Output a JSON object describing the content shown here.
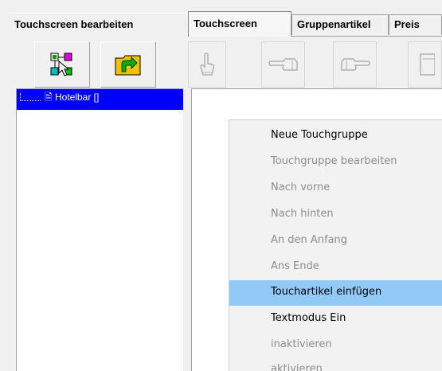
{
  "tabs": {
    "outer": "Touchscreen bearbeiten",
    "inner": [
      "Touchscreen",
      "Gruppenartikel",
      "Preis"
    ]
  },
  "toolbar": {
    "buttons": [
      {
        "icon": "select-cursor-icon",
        "enabled": true
      },
      {
        "icon": "folder-arrow-icon",
        "enabled": true
      },
      {
        "icon": "hand-point-up-icon",
        "enabled": false
      },
      {
        "icon": "hand-point-left-icon",
        "enabled": false
      },
      {
        "icon": "hand-point-right-icon",
        "enabled": false
      },
      {
        "icon": "device-icon",
        "enabled": false
      }
    ]
  },
  "tree": {
    "selected_label": "Hotelbar []"
  },
  "context_menu": {
    "items": [
      {
        "label": "Neue Touchgruppe",
        "enabled": true,
        "highlighted": false
      },
      {
        "label": "Touchgruppe bearbeiten",
        "enabled": false,
        "highlighted": false
      },
      {
        "label": "Nach vorne",
        "enabled": false,
        "highlighted": false
      },
      {
        "label": "Nach hinten",
        "enabled": false,
        "highlighted": false
      },
      {
        "label": "An den Anfang",
        "enabled": false,
        "highlighted": false
      },
      {
        "label": "Ans Ende",
        "enabled": false,
        "highlighted": false
      },
      {
        "label": "Touchartikel einfügen",
        "enabled": true,
        "highlighted": true
      },
      {
        "label": "Textmodus Ein",
        "enabled": true,
        "highlighted": false
      },
      {
        "label": "inaktivieren",
        "enabled": false,
        "highlighted": false
      },
      {
        "label": "aktivieren",
        "enabled": false,
        "highlighted": false
      }
    ]
  },
  "colors": {
    "selection": "#0000ff",
    "menu_highlight": "#91c9f7",
    "disabled_text": "#8c8c8c"
  }
}
